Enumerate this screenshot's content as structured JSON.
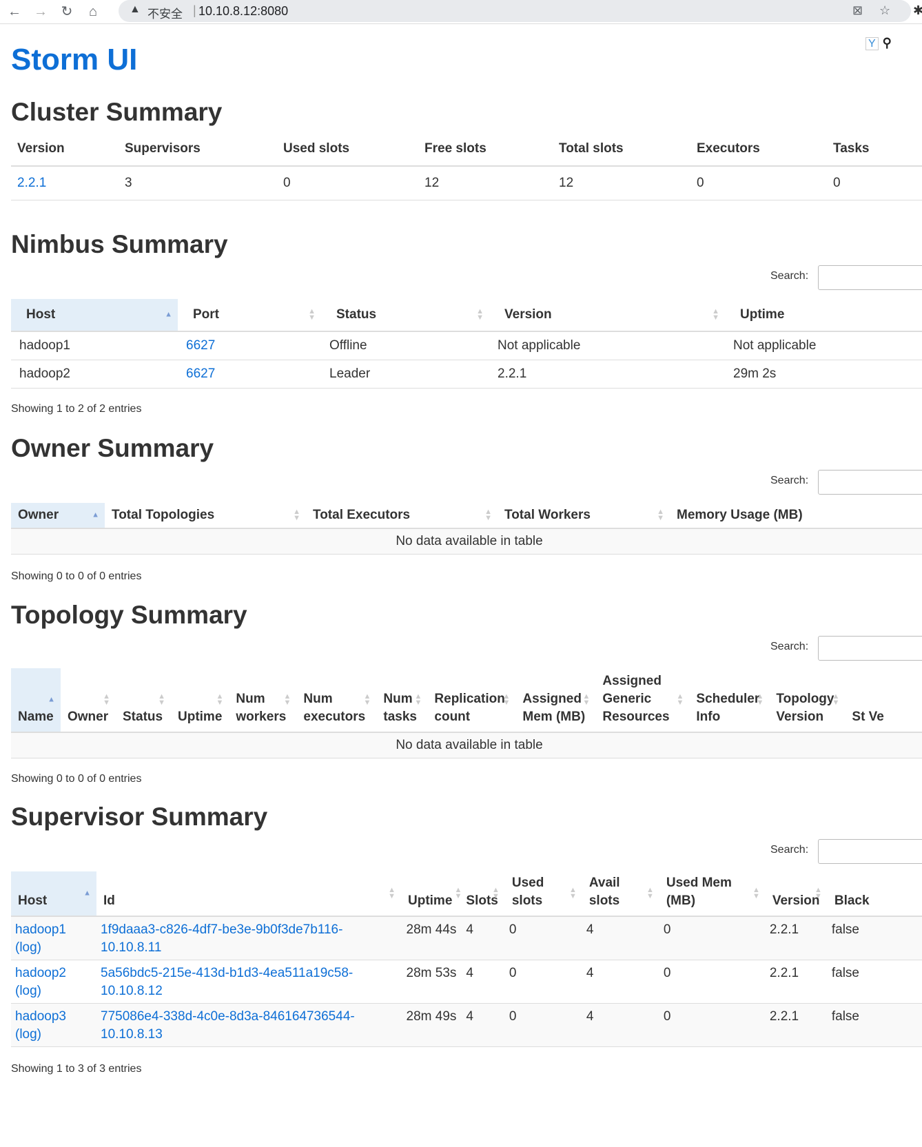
{
  "browser": {
    "security_text": "不安全",
    "url": "10.10.8.12:8080"
  },
  "page_title": "Storm UI",
  "cluster_summary": {
    "heading": "Cluster Summary",
    "columns": [
      "Version",
      "Supervisors",
      "Used slots",
      "Free slots",
      "Total slots",
      "Executors",
      "Tasks"
    ],
    "row": [
      "2.2.1",
      "3",
      "0",
      "12",
      "12",
      "0",
      "0"
    ]
  },
  "nimbus_summary": {
    "heading": "Nimbus Summary",
    "search_label": "Search:",
    "columns": [
      "Host",
      "Port",
      "Status",
      "Version",
      "Uptime"
    ],
    "rows": [
      [
        "hadoop1",
        "6627",
        "Offline",
        "Not applicable",
        "Not applicable"
      ],
      [
        "hadoop2",
        "6627",
        "Leader",
        "2.2.1",
        "29m 2s"
      ]
    ],
    "info": "Showing 1 to 2 of 2 entries"
  },
  "owner_summary": {
    "heading": "Owner Summary",
    "search_label": "Search:",
    "columns": [
      "Owner",
      "Total Topologies",
      "Total Executors",
      "Total Workers",
      "Memory Usage (MB)"
    ],
    "empty": "No data available in table",
    "info": "Showing 0 to 0 of 0 entries"
  },
  "topology_summary": {
    "heading": "Topology Summary",
    "search_label": "Search:",
    "columns": [
      "Name",
      "Owner",
      "Status",
      "Uptime",
      "Num workers",
      "Num executors",
      "Num tasks",
      "Replication count",
      "Assigned Mem (MB)",
      "Assigned Generic Resources",
      "Scheduler Info",
      "Topology Version",
      "St Ve"
    ],
    "empty": "No data available in table",
    "info": "Showing 0 to 0 of 0 entries"
  },
  "supervisor_summary": {
    "heading": "Supervisor Summary",
    "search_label": "Search:",
    "columns": [
      "Host",
      "Id",
      "Uptime",
      "Slots",
      "Used slots",
      "Avail slots",
      "Used Mem (MB)",
      "Version",
      "Black"
    ],
    "rows": [
      {
        "host": "hadoop1",
        "log": "(log)",
        "id": "1f9daaa3-c826-4df7-be3e-9b0f3de7b116-10.10.8.11",
        "uptime": "28m 44s",
        "slots": "4",
        "used": "0",
        "avail": "4",
        "mem": "0",
        "version": "2.2.1",
        "black": "false"
      },
      {
        "host": "hadoop2",
        "log": "(log)",
        "id": "5a56bdc5-215e-413d-b1d3-4ea511a19c58-10.10.8.12",
        "uptime": "28m 53s",
        "slots": "4",
        "used": "0",
        "avail": "4",
        "mem": "0",
        "version": "2.2.1",
        "black": "false"
      },
      {
        "host": "hadoop3",
        "log": "(log)",
        "id": "775086e4-338d-4c0e-8d3a-846164736544-10.10.8.13",
        "uptime": "28m 49s",
        "slots": "4",
        "used": "0",
        "avail": "4",
        "mem": "0",
        "version": "2.2.1",
        "black": "false"
      }
    ],
    "info": "Showing 1 to 3 of 3 entries"
  }
}
